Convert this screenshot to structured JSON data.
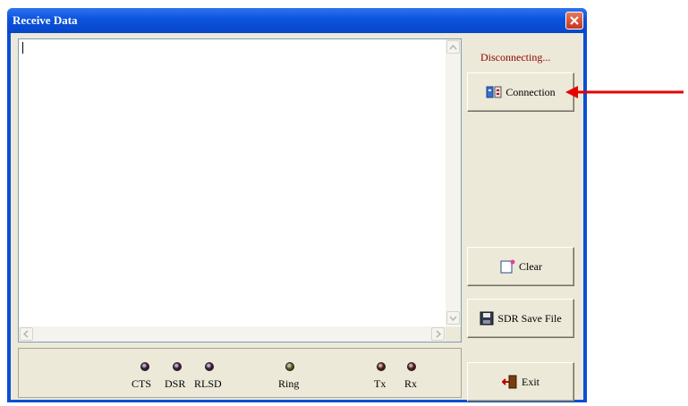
{
  "window": {
    "title": "Receive Data"
  },
  "connection_status": "Disconnecting...",
  "buttons": {
    "connection": "Connection",
    "clear": "Clear",
    "save": "SDR Save File",
    "exit": "Exit"
  },
  "indicators": [
    {
      "label": "CTS",
      "color": "#4b1a44"
    },
    {
      "label": "DSR",
      "color": "#4b1a44"
    },
    {
      "label": "RLSD",
      "color": "#4b1a44"
    },
    {
      "label": "Ring",
      "color": "#6b6616"
    },
    {
      "label": "Tx",
      "color": "#6a1a1a"
    },
    {
      "label": "Rx",
      "color": "#6a1a1a"
    }
  ],
  "colors": {
    "titlebar": "#0a53de",
    "arrow": "#e60000",
    "status_text": "#8b0000"
  }
}
